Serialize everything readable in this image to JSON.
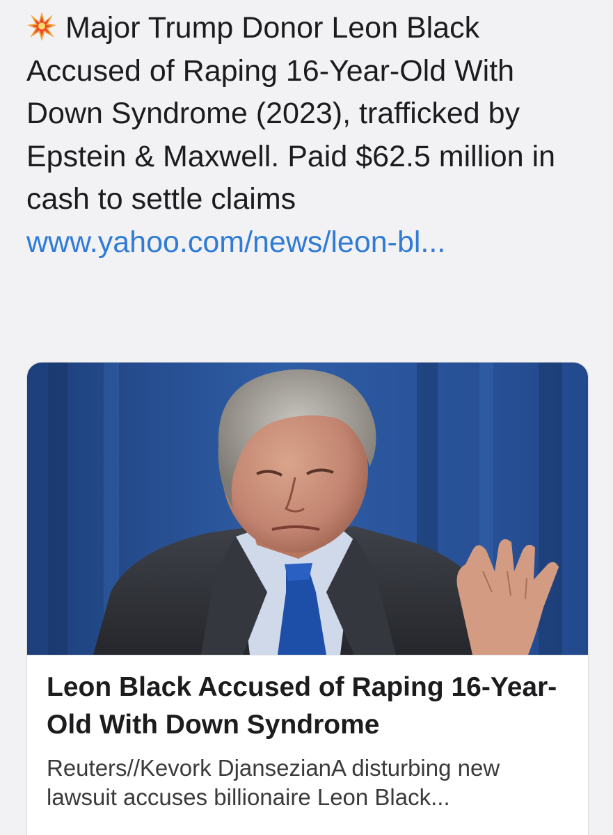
{
  "post": {
    "emoji_icon": "collision-icon",
    "text": "Major Trump Donor Leon Black Accused of Raping 16-Year-Old With Down Syndrome (2023), trafficked by Epstein & Maxwell. Paid $62.5 million in cash to settle claims",
    "link_text": "www.yahoo.com/news/leon-bl..."
  },
  "link_card": {
    "image_alt": "Leon Black speaking, gesturing with right hand",
    "title": "Leon Black Accused of Raping 16-Year-Old With Down Syndrome",
    "description": "Reuters//Kevork DjansezianA disturbing new lawsuit accuses billionaire Leon Black..."
  },
  "colors": {
    "background": "#f2f2f4",
    "text": "#1c1c1e",
    "link": "#2f7bd6",
    "card_background": "#ffffff"
  }
}
